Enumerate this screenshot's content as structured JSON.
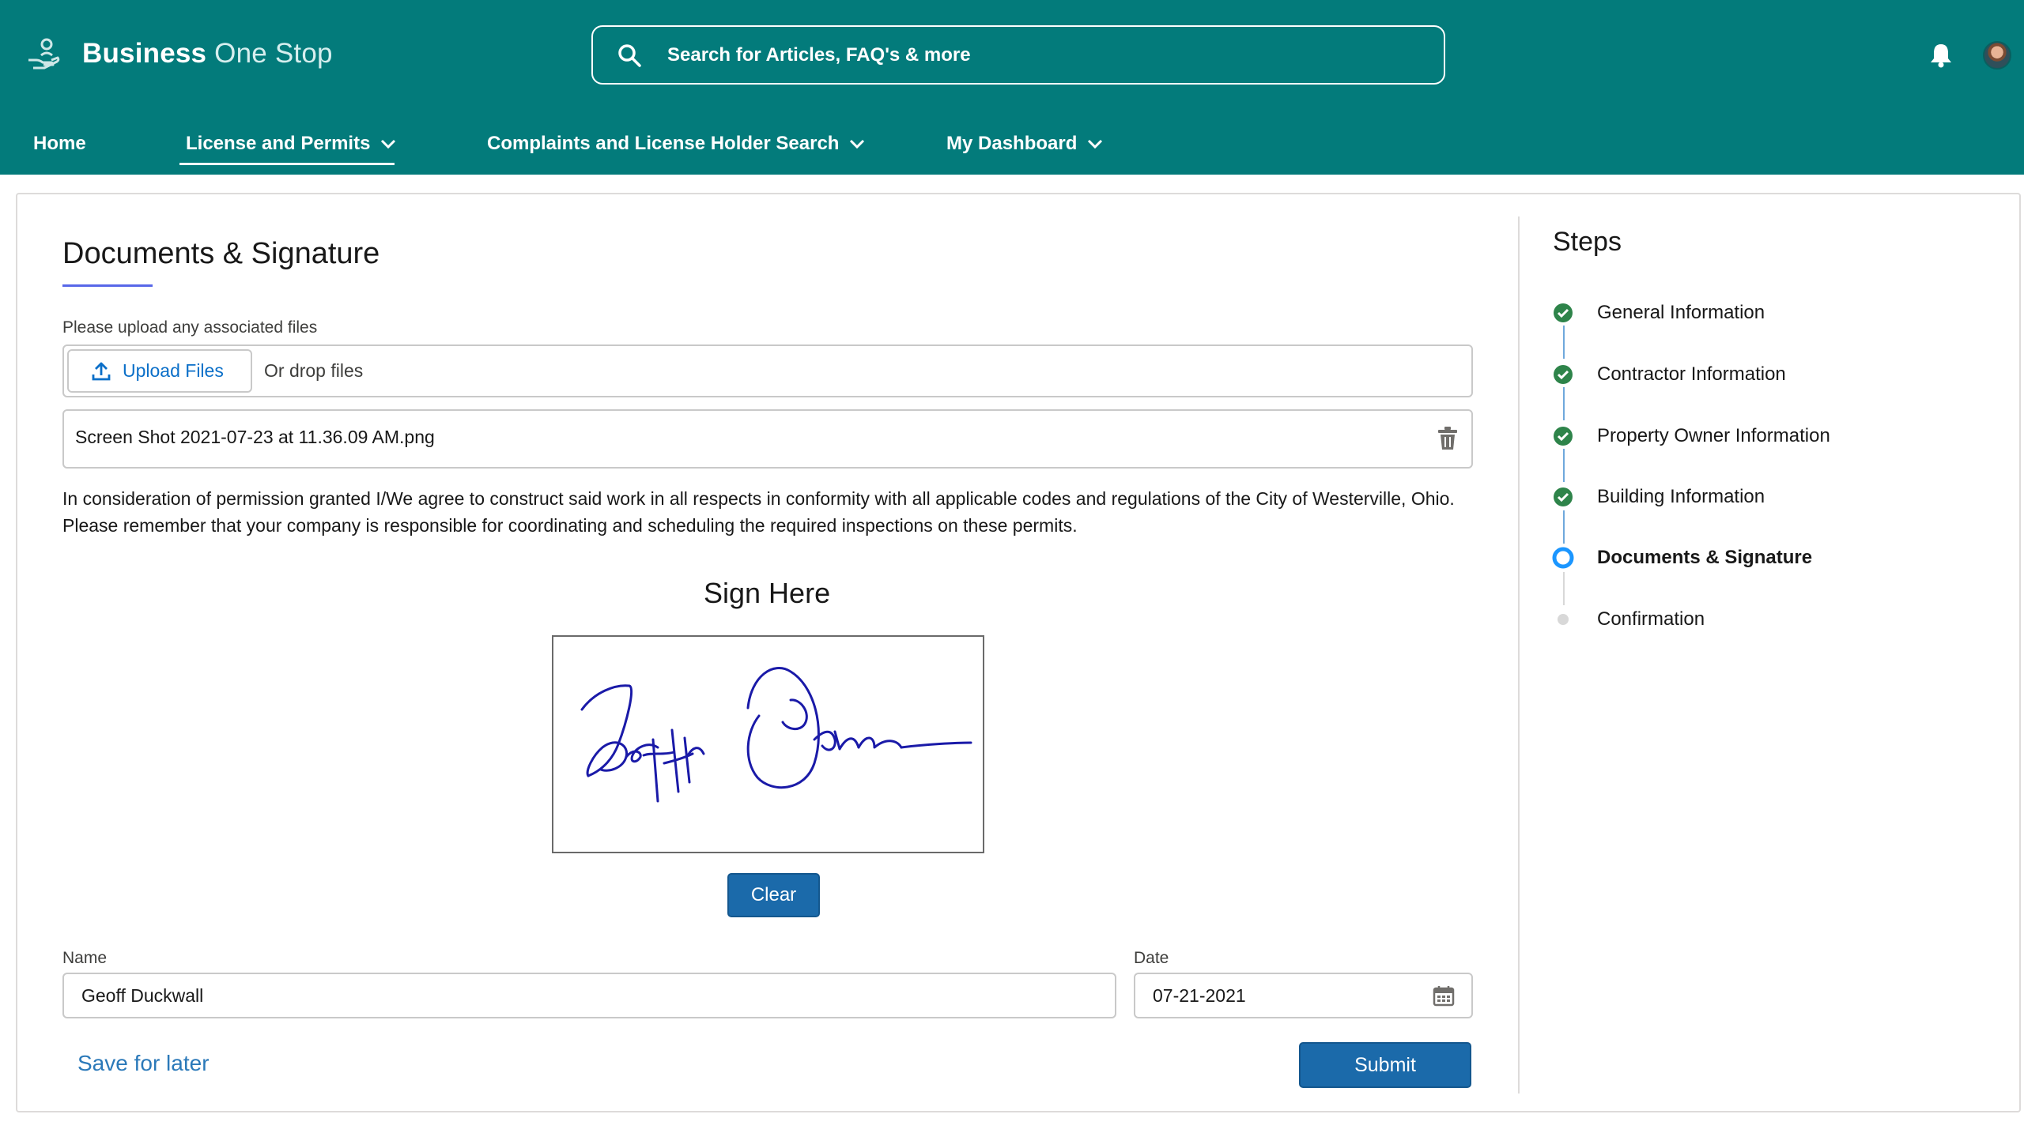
{
  "header": {
    "brand_bold": "Business",
    "brand_light": "One Stop",
    "search_placeholder": "Search for Articles, FAQ's & more",
    "nav": [
      {
        "label": "Home"
      },
      {
        "label": "License and Permits"
      },
      {
        "label": "Complaints and License Holder Search"
      },
      {
        "label": "My Dashboard"
      }
    ]
  },
  "form": {
    "title": "Documents & Signature",
    "upload_label": "Please upload any associated files",
    "upload_button": "Upload Files",
    "drop_text": "Or drop files",
    "file_name": "Screen Shot 2021-07-23 at 11.36.09 AM.png",
    "terms": "In consideration of permission granted I/We agree to construct said work in all respects in conformity with all applicable codes and regulations of the City of Westerville, Ohio. Please remember that your company is responsible for coordinating and scheduling the required inspections on these permits.",
    "sign_title": "Sign Here",
    "clear_button": "Clear",
    "name_label": "Name",
    "name_value": "Geoff Duckwall",
    "date_label": "Date",
    "date_value": "07-21-2021",
    "save_later": "Save for later",
    "submit_button": "Submit"
  },
  "steps": {
    "title": "Steps",
    "items": [
      {
        "label": "General Information",
        "status": "complete"
      },
      {
        "label": "Contractor Information",
        "status": "complete"
      },
      {
        "label": "Property Owner Information",
        "status": "complete"
      },
      {
        "label": "Building Information",
        "status": "complete"
      },
      {
        "label": "Documents & Signature",
        "status": "current"
      },
      {
        "label": "Confirmation",
        "status": "pending"
      }
    ]
  },
  "colors": {
    "header_bg": "#037b7b",
    "primary_button": "#1b6aaa",
    "link": "#0b6fc8",
    "step_complete": "#2e844a",
    "step_current": "#1b96ff",
    "signature_ink": "#1a1aa8"
  }
}
